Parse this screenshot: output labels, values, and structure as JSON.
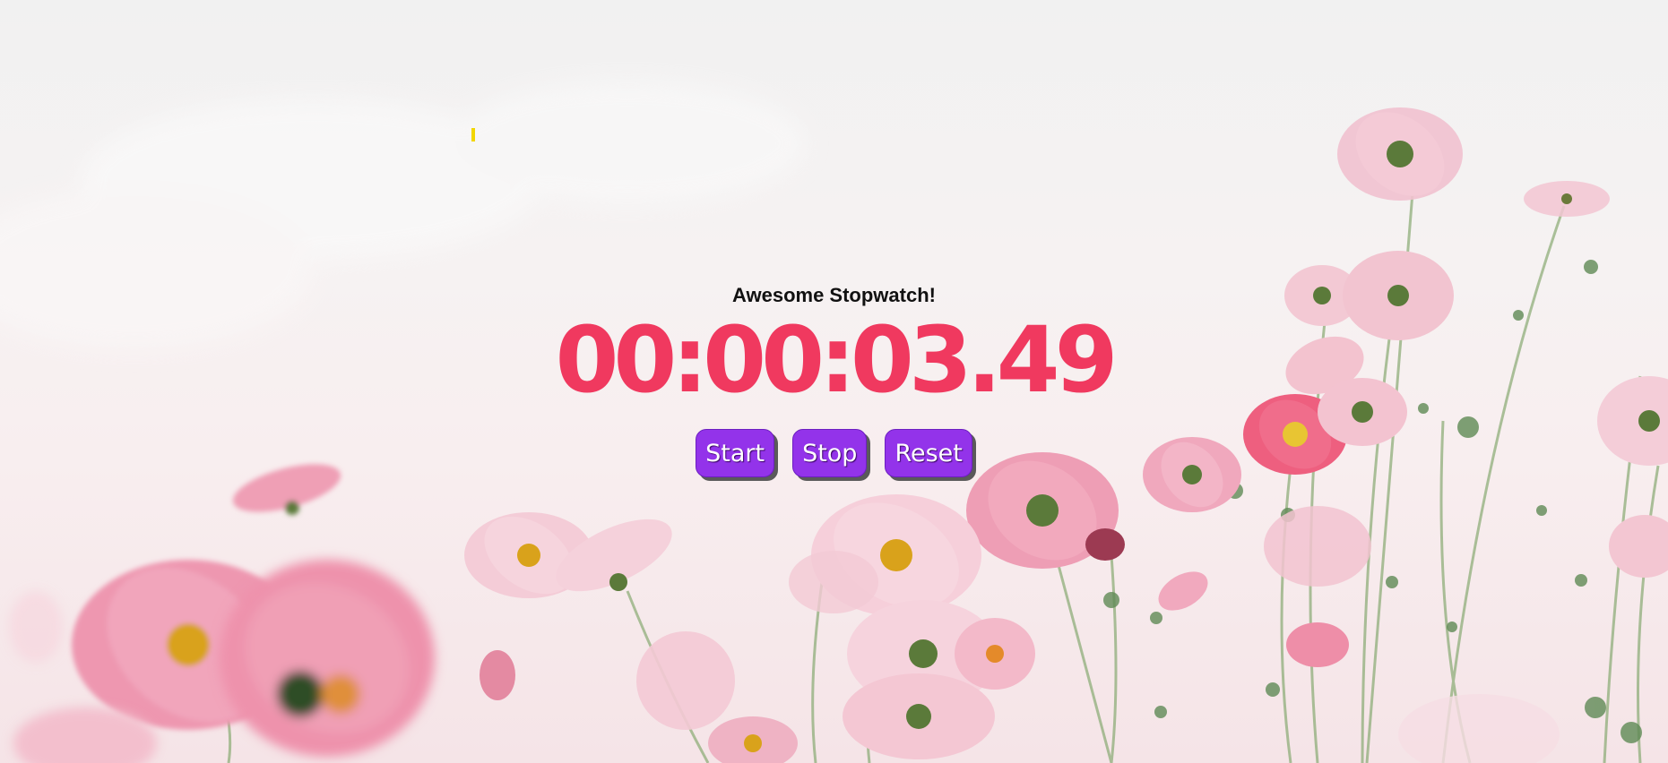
{
  "app": {
    "title": "Awesome Stopwatch!"
  },
  "timer": {
    "display": "00:00:03.49"
  },
  "controls": {
    "start_label": "Start",
    "stop_label": "Stop",
    "reset_label": "Reset"
  },
  "colors": {
    "time_text": "#f0395f",
    "button_bg": "#9333ea",
    "button_text": "#ffffff",
    "title_text": "#111111",
    "cursor_mark": "#f2d600"
  }
}
